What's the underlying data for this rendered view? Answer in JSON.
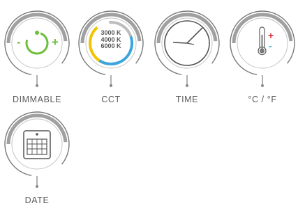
{
  "features": [
    {
      "id": "dimmable",
      "label": "DIMMABLE",
      "icon": "dimmer-icon",
      "minus": "-",
      "plus": "+"
    },
    {
      "id": "cct",
      "label": "CCT",
      "icon": "color-temperature-icon",
      "temps": [
        "3000 K",
        "4000 K",
        "6000 K"
      ]
    },
    {
      "id": "time",
      "label": "TIME",
      "icon": "clock-icon"
    },
    {
      "id": "temp",
      "label": "°C / °F",
      "icon": "thermometer-icon",
      "plus": "+",
      "minus": "-"
    },
    {
      "id": "date",
      "label": "DATE",
      "icon": "calendar-icon"
    }
  ],
  "colors": {
    "ring": "#999999",
    "ring_dark": "#666666",
    "label": "#5b5b5b",
    "dimmer_green": "#6cbf3b",
    "cct_yellow": "#f2c400",
    "cct_blue": "#3aa6dd",
    "thermo_red": "#d7262c",
    "thermo_blue": "#2aa7d6"
  }
}
